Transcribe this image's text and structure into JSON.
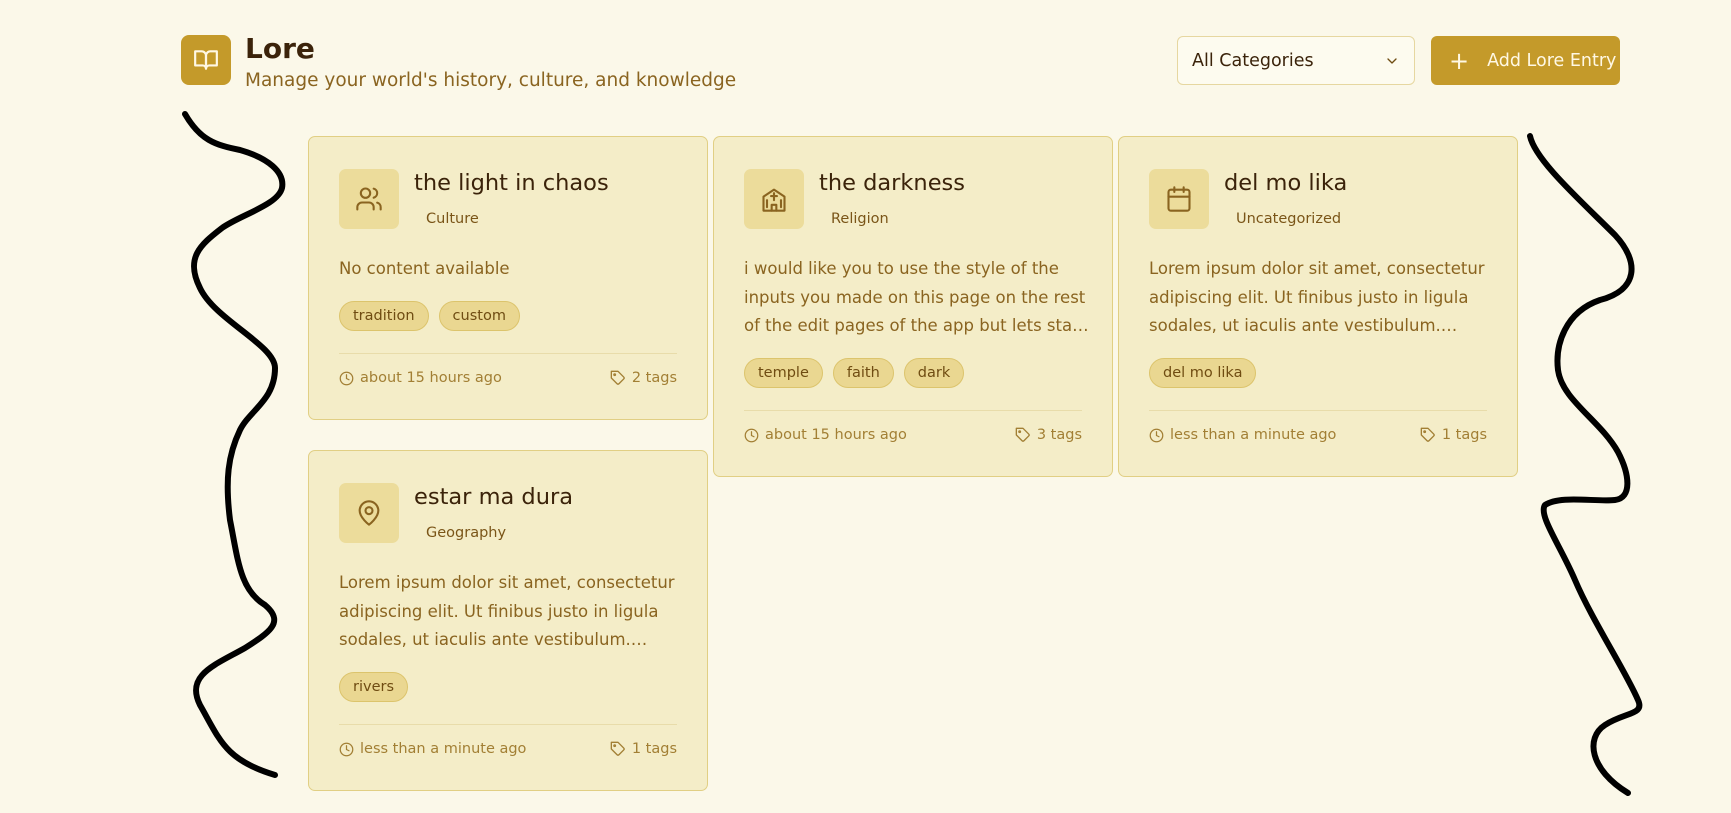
{
  "header": {
    "title": "Lore",
    "subtitle": "Manage your world's history, culture, and knowledge",
    "category_select": "All Categories",
    "add_button": "Add Lore Entry"
  },
  "cards": [
    {
      "title": "the light in chaos",
      "category": "Culture",
      "icon": "users-icon",
      "content": "No content available",
      "tags": [
        "tradition",
        "custom"
      ],
      "time": "about 15 hours ago",
      "tag_count": "2 tags"
    },
    {
      "title": "the darkness",
      "category": "Religion",
      "icon": "temple-icon",
      "content": "i would like you to use the style of the inputs you made on this page on the rest of the edit pages of the app but lets start with",
      "tags": [
        "temple",
        "faith",
        "dark"
      ],
      "time": "about 15 hours ago",
      "tag_count": "3 tags"
    },
    {
      "title": "del mo lika",
      "category": "Uncategorized",
      "icon": "calendar-icon",
      "content": "Lorem ipsum dolor sit amet, consectetur adipiscing elit. Ut finibus justo in ligula sodales, ut iaculis ante vestibulum. Mauris…",
      "tags": [
        "del mo lika"
      ],
      "time": "less than a minute ago",
      "tag_count": "1 tags"
    },
    {
      "title": "estar ma dura",
      "category": "Geography",
      "icon": "map-pin-icon",
      "content": "Lorem ipsum dolor sit amet, consectetur adipiscing elit. Ut finibus justo in ligula sodales, ut iaculis ante vestibulum. Mauris…",
      "tags": [
        "rivers"
      ],
      "time": "less than a minute ago",
      "tag_count": "1 tags"
    }
  ],
  "colors": {
    "background": "#fbf8e9",
    "accent": "#c49a2a",
    "card": "#f4edc8",
    "tag": "#ead791",
    "annotation_ink": "#000000"
  }
}
